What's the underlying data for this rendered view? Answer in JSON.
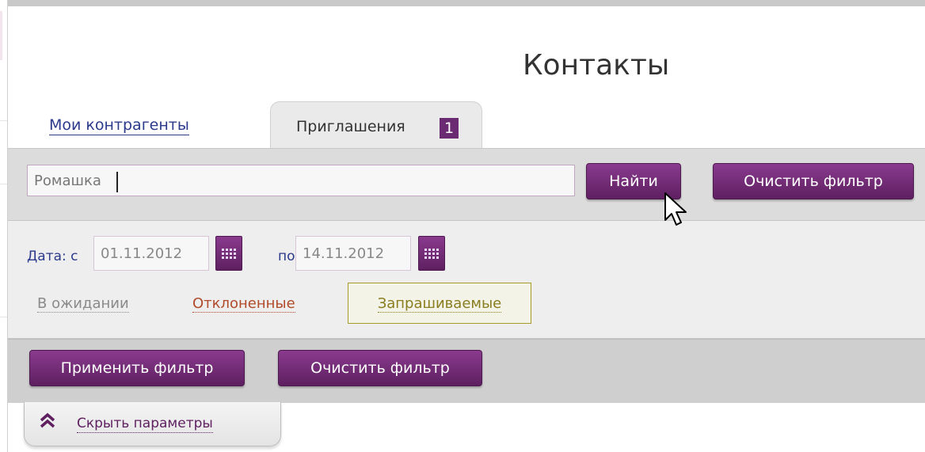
{
  "page": {
    "title": "Контакты"
  },
  "tabs": {
    "my_counterparties": "Мои контрагенты",
    "invitations": {
      "label": "Приглашения",
      "badge": "1"
    }
  },
  "search": {
    "value": "Ромашка",
    "find_label": "Найти",
    "clear_label": "Очистить фильтр"
  },
  "filters": {
    "date_from_label": "Дата: с",
    "date_from": "01.11.2012",
    "date_to_label": "по",
    "date_to": "14.11.2012",
    "statuses": {
      "pending": "В ожидании",
      "rejected": "Отклоненные",
      "requested": "Запрашиваемые"
    },
    "selected_status": "Запрашиваемые"
  },
  "actions": {
    "apply_label": "Применить фильтр",
    "clear_label": "Очистить фильтр"
  },
  "hide_params": {
    "label": "Скрыть параметры"
  },
  "colors": {
    "accent": "#6b2b73",
    "link": "#2b3a8b",
    "rejected": "#b14a2a",
    "requested": "#8a7d1f"
  },
  "icons": {
    "calendar": "calendar-icon",
    "chevrons": "double-chevron-up-icon",
    "cursor": "mouse-pointer-icon"
  }
}
